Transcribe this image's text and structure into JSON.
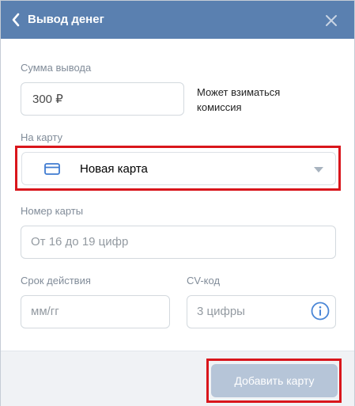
{
  "header": {
    "title": "Вывод денег",
    "back_icon": "chevron-left-icon",
    "close_icon": "close-icon"
  },
  "amount": {
    "label": "Сумма вывода",
    "value": "300 ₽",
    "hint": "Может взиматься комиссия"
  },
  "card_select": {
    "label": "На карту",
    "selected": "Новая карта",
    "icon": "credit-card-icon",
    "dropdown_icon": "chevron-down-icon"
  },
  "card_number": {
    "label": "Номер карты",
    "placeholder": "От 16 до 19 цифр"
  },
  "expiry": {
    "label": "Срок действия",
    "placeholder": "мм/гг"
  },
  "cvv": {
    "label": "CV-код",
    "placeholder": "3 цифры",
    "info_icon": "info-icon"
  },
  "footer": {
    "submit_label": "Добавить карту"
  },
  "colors": {
    "header_bg": "#5a80b0",
    "highlight": "#d9161c",
    "button_disabled": "#b6c5d8",
    "footer_bg": "#f0f2f5"
  }
}
